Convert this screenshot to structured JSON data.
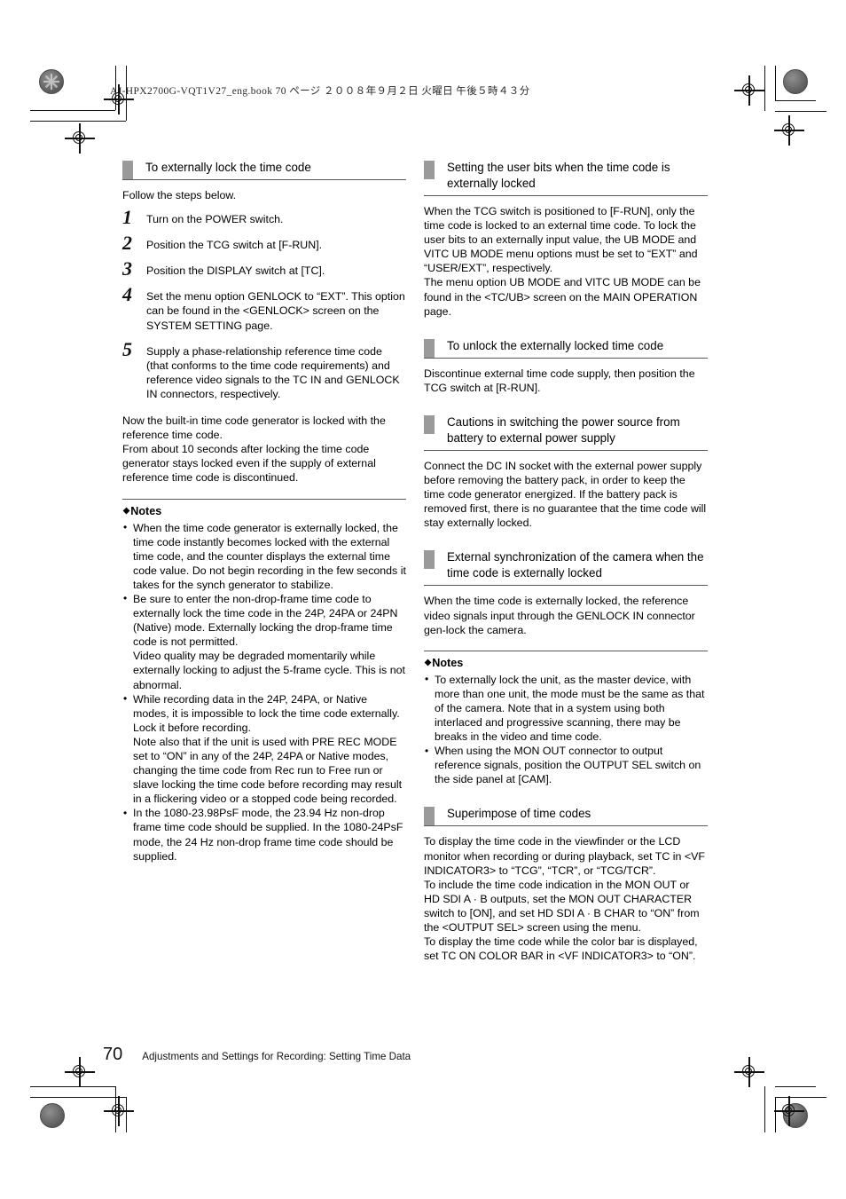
{
  "page": {
    "file_header": "AJ-HPX2700G-VQT1V27_eng.book   70 ページ   ２００８年９月２日   火曜日   午後５時４３分",
    "page_number": "70",
    "footer_breadcrumb": "Adjustments and Settings for Recording: Setting Time Data",
    "accent_gray": "#9a9a9a",
    "rule_color": "#5a5a5a"
  },
  "left_column": {
    "section1": {
      "heading": "To externally lock the time code",
      "intro": "Follow the steps below.",
      "steps": [
        {
          "num": "1",
          "text": "Turn on the POWER switch."
        },
        {
          "num": "2",
          "text": "Position the TCG switch at [F-RUN]."
        },
        {
          "num": "3",
          "text": "Position the DISPLAY switch at [TC]."
        },
        {
          "num": "4",
          "text": "Set the menu option GENLOCK to “EXT”. This option can be found in the <GENLOCK> screen on the SYSTEM SETTING page."
        },
        {
          "num": "5",
          "text": "Supply a phase-relationship reference time code (that conforms to the time code requirements) and reference video signals to the TC IN and GENLOCK IN connectors, respectively."
        }
      ],
      "after_steps": "Now the built-in time code generator is locked with the reference time code.\nFrom about 10 seconds after locking the time code generator stays locked even if the supply of external reference time code is discontinued."
    },
    "notes": {
      "title": "Notes",
      "diamond": "◆",
      "items": [
        "When the time code generator is externally locked, the time code instantly becomes locked with the external time code, and the counter displays the external time code value. Do not begin recording in the few seconds it takes for the synch generator to stabilize.",
        "Be sure to enter the non-drop-frame time code to externally lock the time code in the 24P, 24PA or 24PN (Native) mode. Externally locking the drop-frame time code is not permitted.\nVideo quality may be degraded momentarily while externally locking to adjust the 5-frame cycle. This is not abnormal.",
        "While recording data in the 24P, 24PA, or Native modes, it is impossible to lock the time code externally. Lock it before recording.\nNote also that if the unit is used with PRE REC MODE set to “ON” in any of the 24P, 24PA or Native modes, changing the time code from Rec run to Free run or slave locking the time code before recording may result in a flickering video or a stopped code being recorded.",
        "In the 1080-23.98PsF mode, the 23.94 Hz non-drop frame time code should be supplied. In the 1080-24PsF mode, the 24 Hz non-drop frame time code should be supplied."
      ]
    }
  },
  "right_column": {
    "section1": {
      "heading": "Setting the user bits when the time code is externally locked",
      "body": "When the TCG switch is positioned to [F-RUN], only the time code is locked to an external time code. To lock the user bits to an externally input value, the UB MODE and VITC UB MODE menu options must be set to “EXT” and “USER/EXT”, respectively.\nThe menu option UB MODE and VITC UB MODE can be found in the <TC/UB> screen on the MAIN OPERATION page."
    },
    "section2": {
      "heading": "To unlock the externally locked time code",
      "body": "Discontinue external time code supply, then position the TCG switch at [R-RUN]."
    },
    "section3": {
      "heading": "Cautions in switching the power source from battery to external power supply",
      "body": "Connect the DC IN socket with the external power supply before removing the battery pack, in order to keep the time code generator energized. If the battery pack is removed first, there is no guarantee that the time code will stay externally locked."
    },
    "section4": {
      "heading": "External synchronization of the camera when the time code is externally locked",
      "body": "When the time code is externally locked, the reference video signals input through the GENLOCK IN connector gen-lock the camera."
    },
    "notes": {
      "title": "Notes",
      "diamond": "◆",
      "items": [
        "To externally lock the unit, as the master device, with more than one unit, the mode must be the same as that of the camera. Note that in a system using both interlaced and progressive scanning, there may be breaks in the video and time code.",
        "When using the MON OUT connector to output reference signals, position the OUTPUT SEL switch on the side panel at [CAM]."
      ]
    },
    "section5": {
      "heading": "Superimpose of time codes",
      "body": "To display the time code in the viewfinder or the LCD monitor when recording or during playback, set TC in <VF INDICATOR3> to “TCG”, “TCR”, or “TCG/TCR”.\nTo include the time code indication in the MON OUT or HD SDI A · B outputs, set the MON OUT CHARACTER switch to [ON], and set HD SDI A · B CHAR to “ON” from the <OUTPUT SEL> screen using the menu.\nTo display the time code while the color bar is displayed, set TC ON COLOR BAR in <VF INDICATOR3> to “ON”."
    }
  }
}
